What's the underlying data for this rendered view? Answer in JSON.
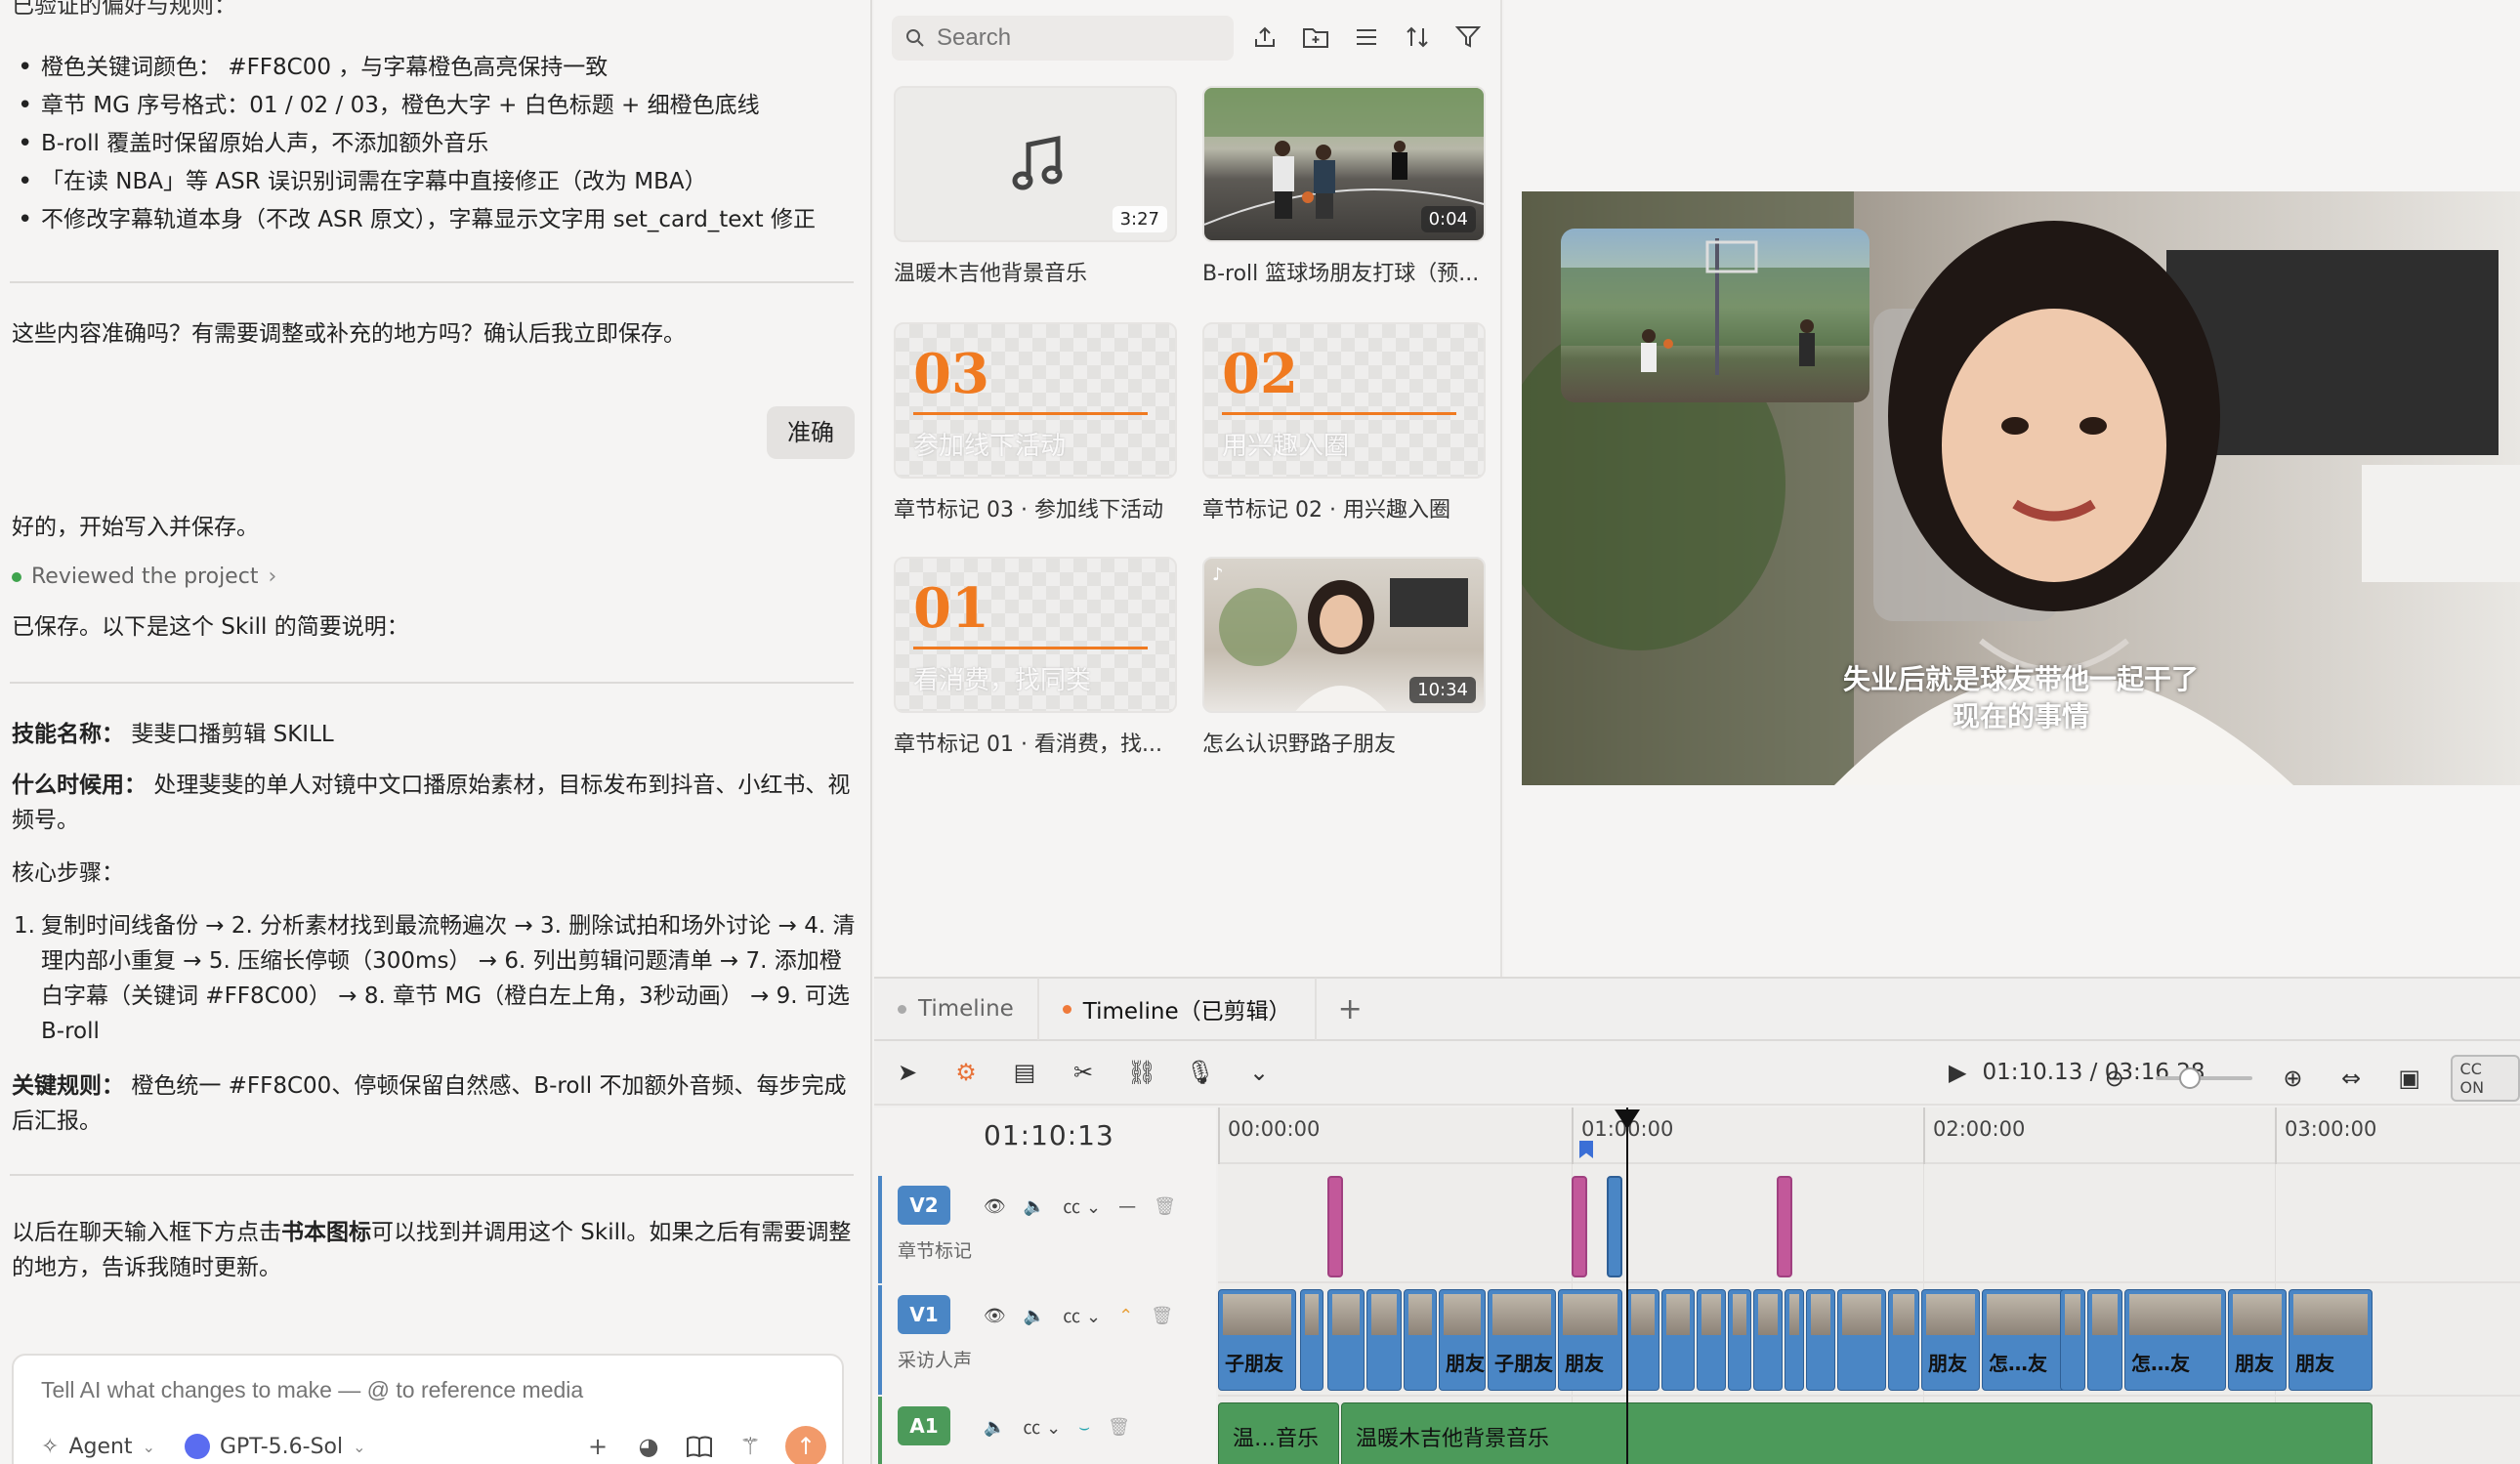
{
  "chat": {
    "top_clipped": "已验证的偏好与规则：",
    "rules": [
      "橙色关键词颜色： #FF8C00 ，与字幕橙色高亮保持一致",
      "章节 MG 序号格式：01 / 02 / 03，橙色大字 + 白色标题 + 细橙色底线",
      "B-roll 覆盖时保留原始人声，不添加额外音乐",
      "「在读 NBA」等 ASR 误识别词需在字幕中直接修正（改为 MBA）",
      "不修改字幕轨道本身（不改 ASR 原文），字幕显示文字用 set_card_text 修正"
    ],
    "question": "这些内容准确吗？有需要调整或补充的地方吗？确认后我立即保存。",
    "user_reply": "准确",
    "ack": "好的，开始写入并保存。",
    "status": "Reviewed the project",
    "saved": "已保存。以下是这个 Skill 的简要说明：",
    "skill_name_label": "技能名称：",
    "skill_name": "斐斐口播剪辑 SKILL",
    "when_label": "什么时候用：",
    "when_text": "处理斐斐的单人对镜中文口播原始素材，目标发布到抖音、小红书、视频号。",
    "steps_label": "核心步骤：",
    "steps_num": "1.",
    "steps_text": "复制时间线备份 → 2. 分析素材找到最流畅遍次 → 3. 删除试拍和场外讨论 → 4. 清理内部小重复 → 5. 压缩长停顿（300ms） → 6. 列出剪辑问题清单 → 7. 添加橙白字幕（关键词 #FF8C00） → 8. 章节 MG（橙白左上角，3秒动画） → 9. 可选 B-roll",
    "rules_label": "关键规则：",
    "rules_text": "橙色统一 #FF8C00、停顿保留自然感、B-roll 不加额外音频、每步完成后汇报。",
    "footer_pre": "以后在聊天输入框下方点击",
    "footer_bold": "书本图标",
    "footer_post": "可以找到并调用这个 Skill。如果之后有需要调整的地方，告诉我随时更新。",
    "composer_placeholder": "Tell AI what changes to make — @ to reference media",
    "agent_label": "Agent",
    "model_label": "GPT-5.6-Sol"
  },
  "media": {
    "search_placeholder": "Search",
    "items": [
      {
        "caption": "温暖木吉他背景音乐",
        "duration": "3:27",
        "kind": "audio"
      },
      {
        "caption": "B-roll 篮球场朋友打球（预...",
        "duration": "0:04",
        "kind": "video"
      },
      {
        "caption": "章节标记 03 · 参加线下活动",
        "num": "03",
        "sub": "参加线下活动",
        "kind": "chapter"
      },
      {
        "caption": "章节标记 02 · 用兴趣入圈",
        "num": "02",
        "sub": "用兴趣入圈",
        "kind": "chapter"
      },
      {
        "caption": "章节标记 01 · 看消费，找...",
        "num": "01",
        "sub": "看消费，找同类",
        "kind": "chapter"
      },
      {
        "caption": "怎么认识野路子朋友",
        "duration": "10:34",
        "kind": "video"
      }
    ]
  },
  "preview": {
    "subtitle_line1": "失业后就是球友带他一起干了",
    "subtitle_line2": "现在的事情"
  },
  "timeline": {
    "tabs": [
      "Timeline",
      "Timeline（已剪辑）"
    ],
    "current_time": "01:10.13 / 03:16.28",
    "playhead_time": "01:10:13",
    "cc_label": "ON",
    "ruler": [
      "00:00:00",
      "01:00:00",
      "02:00:00",
      "03:00:00"
    ],
    "tracks": [
      {
        "id": "V2",
        "name": "章节标记",
        "color": "#4a86c5"
      },
      {
        "id": "V1",
        "name": "采访人声",
        "color": "#4a86c5"
      },
      {
        "id": "A1",
        "name": "",
        "color": "#4c9a5a"
      }
    ],
    "v1_labels": [
      "子朋友",
      "朋友",
      "子朋友",
      "朋友",
      "朋友",
      "怎…友",
      "怎…友",
      "朋友",
      "朋友"
    ],
    "a1_labels": [
      "温…音乐",
      "温暖木吉他背景音乐"
    ]
  }
}
